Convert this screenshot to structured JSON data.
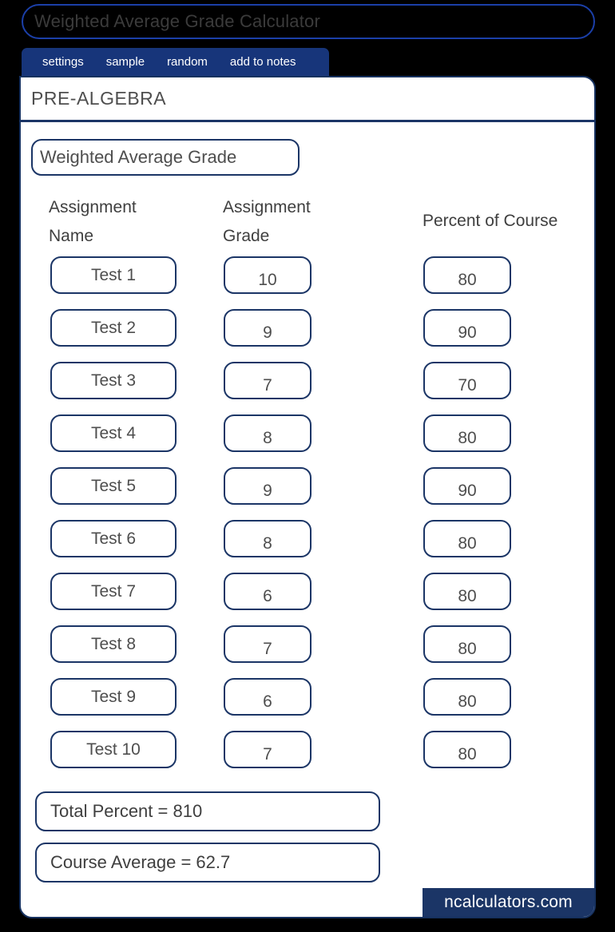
{
  "titlebar": {
    "title": "Weighted Average Grade Calculator"
  },
  "nav": {
    "items": [
      {
        "label": "settings"
      },
      {
        "label": "sample"
      },
      {
        "label": "random"
      },
      {
        "label": "add to notes"
      }
    ]
  },
  "panel": {
    "subject": "PRE-ALGEBRA",
    "calculator_title": "Weighted Average Grade",
    "columns": {
      "name": "Assignment Name",
      "grade": "Assignment Grade",
      "percent": "Percent of Course"
    },
    "rows": [
      {
        "name": "Test 1",
        "grade": "10",
        "percent": "80"
      },
      {
        "name": "Test 2",
        "grade": "9",
        "percent": "90"
      },
      {
        "name": "Test 3",
        "grade": "7",
        "percent": "70"
      },
      {
        "name": "Test 4",
        "grade": "8",
        "percent": "80"
      },
      {
        "name": "Test 5",
        "grade": "9",
        "percent": "90"
      },
      {
        "name": "Test 6",
        "grade": "8",
        "percent": "80"
      },
      {
        "name": "Test 7",
        "grade": "6",
        "percent": "80"
      },
      {
        "name": "Test 8",
        "grade": "7",
        "percent": "80"
      },
      {
        "name": "Test 9",
        "grade": "6",
        "percent": "80"
      },
      {
        "name": "Test 10",
        "grade": "7",
        "percent": "80"
      }
    ],
    "totals": {
      "total_percent": "Total Percent = 810",
      "course_average": "Course Average = 62.7"
    },
    "footer_badge": "ncalculators.com"
  },
  "colors": {
    "navy_border": "#1b3566",
    "nav_blue": "#17357a",
    "title_border_blue": "#1b3fa8",
    "background": "#000000",
    "panel": "#ffffff",
    "text_grey": "#4e4e4e"
  }
}
